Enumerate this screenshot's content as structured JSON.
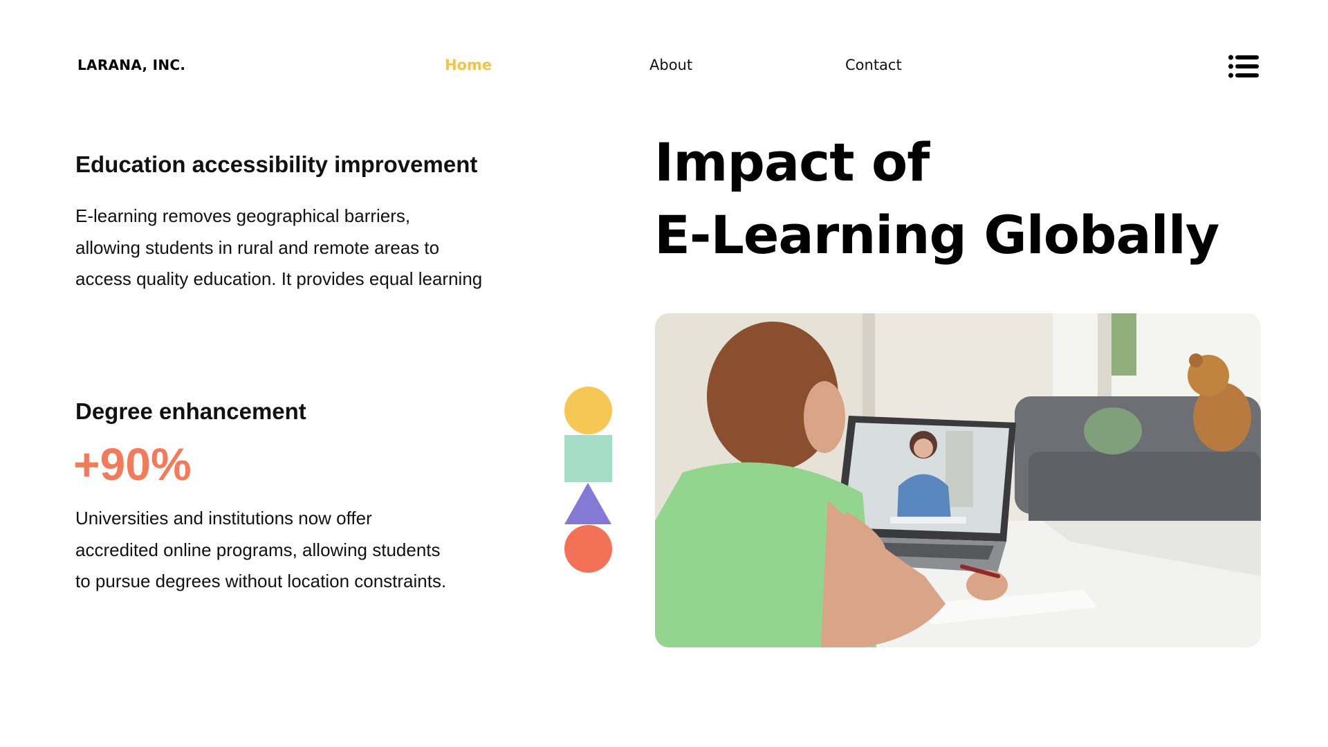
{
  "header": {
    "brand": "LARANA, INC.",
    "nav": [
      {
        "label": "Home",
        "active": true
      },
      {
        "label": "About",
        "active": false
      },
      {
        "label": "Contact",
        "active": false
      }
    ],
    "menu_icon": "hamburger-list-icon"
  },
  "left": {
    "section1": {
      "heading": "Education accessibility improvement",
      "body_lines": [
        "E-learning removes geographical barriers,",
        "allowing students in rural and remote areas to",
        "access quality education. It provides equal learning"
      ]
    },
    "section2": {
      "heading": "Degree enhancement",
      "stat": "+90%",
      "body_lines": [
        "Universities and institutions now offer",
        "accredited online programs, allowing students",
        "to pursue degrees without location constraints."
      ]
    }
  },
  "title_lines": [
    "Impact of",
    "E-Learning Globally"
  ],
  "colors": {
    "accent_yellow": "#f2c34b",
    "stat_orange": "#f07c5c",
    "shape_yellow": "#f5c855",
    "shape_mint": "#a4dcc5",
    "shape_purple": "#8579d6",
    "shape_orange": "#f27157"
  }
}
